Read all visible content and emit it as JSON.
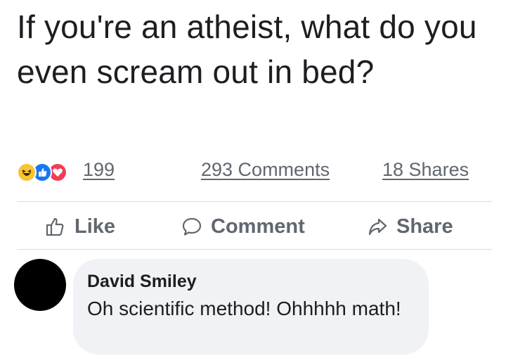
{
  "post": {
    "text": "If you're an atheist, what do you even scream out in bed?"
  },
  "stats": {
    "reaction_icons": [
      "haha-icon",
      "like-icon",
      "love-icon"
    ],
    "reactions_count": "199",
    "comments": "293 Comments",
    "shares": "18 Shares"
  },
  "actions": {
    "like": "Like",
    "comment": "Comment",
    "share": "Share"
  },
  "comment": {
    "author": "David Smiley",
    "text": "Oh scientific method! Ohhhhh math!"
  },
  "colors": {
    "like_blue": "#1877f2",
    "love_red": "#f33e58",
    "haha_yellow": "#f7c433",
    "secondary_text": "#606770",
    "bubble_bg": "#f0f2f5"
  }
}
